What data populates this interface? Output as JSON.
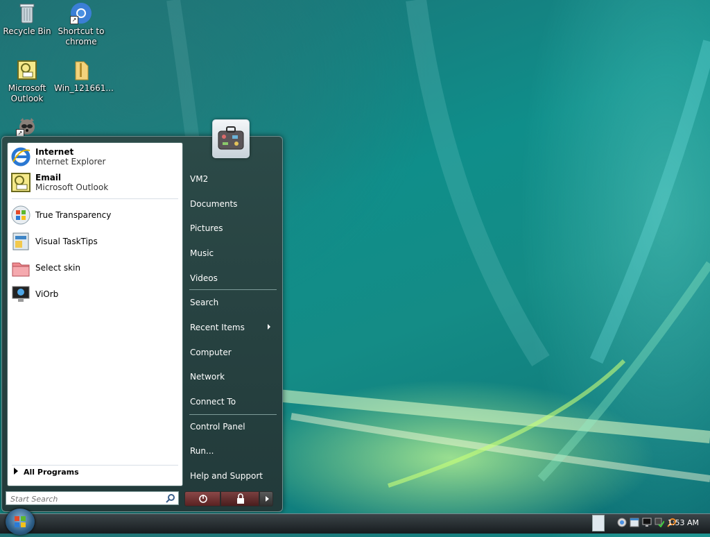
{
  "desktop_icons": [
    {
      "label": "Recycle Bin",
      "icon": "recycle-bin-icon"
    },
    {
      "label": "Shortcut to chrome",
      "icon": "chrome-icon"
    },
    {
      "label": "Microsoft Outlook",
      "icon": "outlook-icon"
    },
    {
      "label": "Win_121661...",
      "icon": "zip-folder-icon"
    },
    {
      "label": "",
      "icon": "raccoon-app-icon"
    }
  ],
  "start_menu": {
    "pinned": [
      {
        "title": "Internet",
        "subtitle": "Internet Explorer",
        "icon": "internet-explorer-icon"
      },
      {
        "title": "Email",
        "subtitle": "Microsoft Outlook",
        "icon": "outlook-icon"
      }
    ],
    "recent": [
      {
        "label": "True Transparency",
        "icon": "windows-flag-icon"
      },
      {
        "label": "Visual TaskTips",
        "icon": "tasktips-icon"
      },
      {
        "label": "Select skin",
        "icon": "skin-icon"
      },
      {
        "label": "ViOrb",
        "icon": "monitor-icon"
      }
    ],
    "all_programs": "All Programs",
    "search_placeholder": "Start Search",
    "right_items": [
      "VM2",
      "Documents",
      "Pictures",
      "Music",
      "Videos",
      "Search",
      "Recent Items",
      "Computer",
      "Network",
      "Connect To",
      "Control Panel",
      "Run...",
      "Help and Support"
    ]
  },
  "taskbar": {
    "clock": "1:53 AM"
  },
  "colors": {
    "wallpaper": "#118a86",
    "menu_bg": "#2a4644",
    "taskbar_bg": "#1f2528"
  }
}
